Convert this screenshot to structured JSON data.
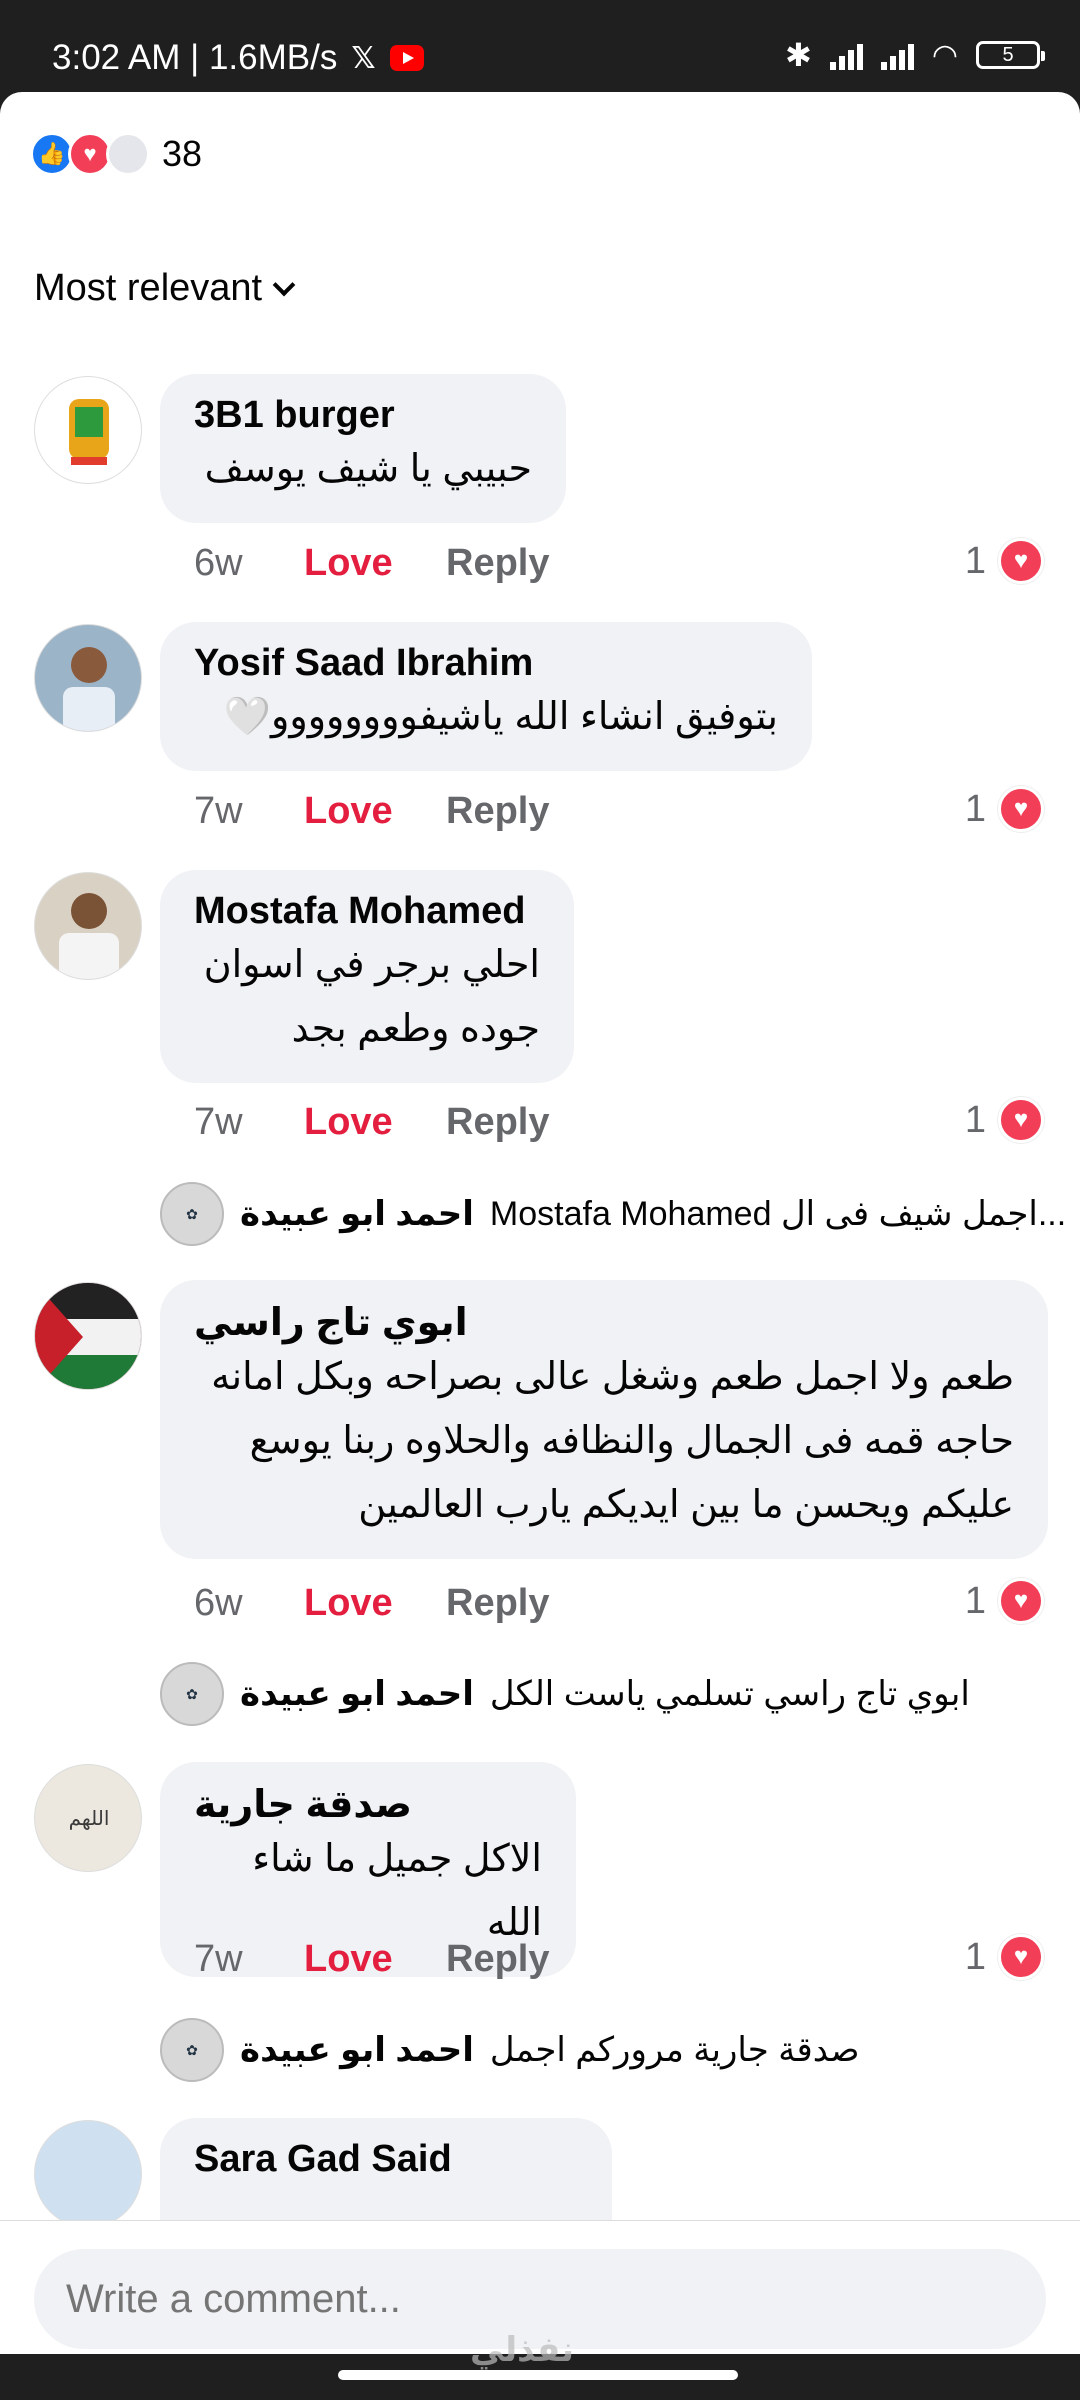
{
  "status_bar": {
    "time": "3:02 AM | 1.6MB/s",
    "battery": "5"
  },
  "reactions": {
    "count": "38"
  },
  "sort": {
    "label": "Most relevant"
  },
  "comments": [
    {
      "author": "3B1  burger",
      "lines": [
        "حبيبي يا شيف يوسف"
      ],
      "time": "6w",
      "love": "Love",
      "reply": "Reply",
      "likes": "1"
    },
    {
      "author": "Yosif Saad Ibrahim",
      "lines": [
        "بتوفيق انشاء الله ياشيفوووووووو🤍"
      ],
      "time": "7w",
      "love": "Love",
      "reply": "Reply",
      "likes": "1"
    },
    {
      "author": "Mostafa Mohamed",
      "lines": [
        "احلي برجر في اسوان",
        "جوده وطعم بجد"
      ],
      "time": "7w",
      "love": "Love",
      "reply": "Reply",
      "likes": "1"
    },
    {
      "author": "ابوي تاج  راسي",
      "lines": [
        "طعم ولا اجمل طعم وشغل عالى بصراحه وبكل امانه",
        "حاجه قمه فى الجمال والنظافه والحلاوه ربنا يوسع",
        "عليكم ويحسن ما بين ايديكم يارب العالمين"
      ],
      "time": "6w",
      "love": "Love",
      "reply": "Reply",
      "likes": "1"
    },
    {
      "author": "صدقة جارية",
      "lines": [
        "الاكل جميل ما شاء الله"
      ],
      "time": "7w",
      "love": "Love",
      "reply": "Reply",
      "likes": "1"
    },
    {
      "author": "Sara Gad Said",
      "lines": []
    }
  ],
  "replies": [
    {
      "author": "احمد ابو عبيدة",
      "text": "Mostafa Mohamed اجمل شيف فى ال..."
    },
    {
      "author": "احمد ابو عبيدة",
      "text": "ابوي تاج  راسي تسلمي ياست الكل"
    },
    {
      "author": "احمد ابو عبيدة",
      "text": "صدقة جارية مروركم اجمل"
    }
  ],
  "composer": {
    "placeholder": "Write a comment..."
  },
  "watermark": "نفذلي"
}
